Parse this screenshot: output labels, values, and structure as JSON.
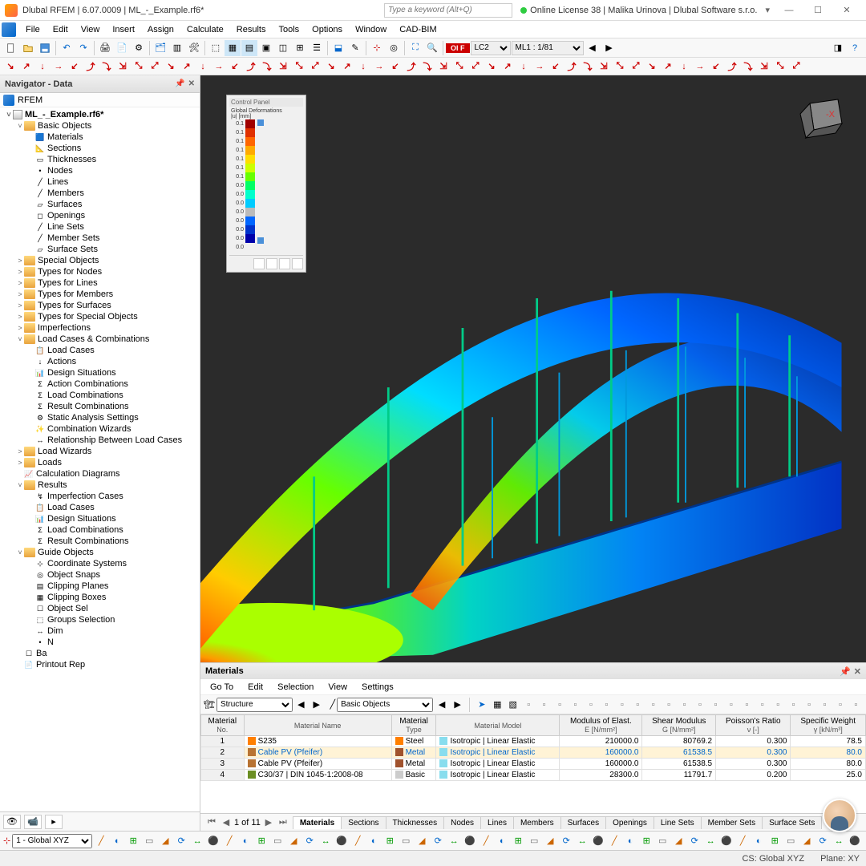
{
  "title_bar": {
    "title": "Dlubal RFEM | 6.07.0009 | ML_-_Example.rf6*",
    "search_placeholder": "Type a keyword (Alt+Q)",
    "license": "Online License 38 | Malika Urinova | Dlubal Software s.r.o."
  },
  "menu": [
    "File",
    "Edit",
    "View",
    "Insert",
    "Assign",
    "Calculate",
    "Results",
    "Tools",
    "Options",
    "Window",
    "CAD-BIM"
  ],
  "toolbar": {
    "lc_label": "Ol F",
    "lc_sel": "LC2",
    "ml_sel": "ML1 : 1/81"
  },
  "navigator": {
    "title": "Navigator - Data",
    "root": "RFEM",
    "project": "ML_-_Example.rf6*",
    "tree": [
      {
        "l": 1,
        "t": "Basic Objects",
        "tw": "˅",
        "fold": true
      },
      {
        "l": 2,
        "t": "Materials",
        "ic": "🟦"
      },
      {
        "l": 2,
        "t": "Sections",
        "ic": "📐"
      },
      {
        "l": 2,
        "t": "Thicknesses",
        "ic": "▭"
      },
      {
        "l": 2,
        "t": "Nodes",
        "ic": "•"
      },
      {
        "l": 2,
        "t": "Lines",
        "ic": "╱"
      },
      {
        "l": 2,
        "t": "Members",
        "ic": "╱"
      },
      {
        "l": 2,
        "t": "Surfaces",
        "ic": "▱"
      },
      {
        "l": 2,
        "t": "Openings",
        "ic": "◻"
      },
      {
        "l": 2,
        "t": "Line Sets",
        "ic": "╱"
      },
      {
        "l": 2,
        "t": "Member Sets",
        "ic": "╱"
      },
      {
        "l": 2,
        "t": "Surface Sets",
        "ic": "▱"
      },
      {
        "l": 1,
        "t": "Special Objects",
        "tw": ">",
        "fold": true
      },
      {
        "l": 1,
        "t": "Types for Nodes",
        "tw": ">",
        "fold": true
      },
      {
        "l": 1,
        "t": "Types for Lines",
        "tw": ">",
        "fold": true
      },
      {
        "l": 1,
        "t": "Types for Members",
        "tw": ">",
        "fold": true
      },
      {
        "l": 1,
        "t": "Types for Surfaces",
        "tw": ">",
        "fold": true
      },
      {
        "l": 1,
        "t": "Types for Special Objects",
        "tw": ">",
        "fold": true
      },
      {
        "l": 1,
        "t": "Imperfections",
        "tw": ">",
        "fold": true
      },
      {
        "l": 1,
        "t": "Load Cases & Combinations",
        "tw": "˅",
        "fold": true
      },
      {
        "l": 2,
        "t": "Load Cases",
        "ic": "📋"
      },
      {
        "l": 2,
        "t": "Actions",
        "ic": "↓"
      },
      {
        "l": 2,
        "t": "Design Situations",
        "ic": "📊"
      },
      {
        "l": 2,
        "t": "Action Combinations",
        "ic": "Σ"
      },
      {
        "l": 2,
        "t": "Load Combinations",
        "ic": "Σ"
      },
      {
        "l": 2,
        "t": "Result Combinations",
        "ic": "Σ"
      },
      {
        "l": 2,
        "t": "Static Analysis Settings",
        "ic": "⚙"
      },
      {
        "l": 2,
        "t": "Combination Wizards",
        "ic": "✨"
      },
      {
        "l": 2,
        "t": "Relationship Between Load Cases",
        "ic": "↔"
      },
      {
        "l": 1,
        "t": "Load Wizards",
        "tw": ">",
        "fold": true
      },
      {
        "l": 1,
        "t": "Loads",
        "tw": ">",
        "fold": true
      },
      {
        "l": 1,
        "t": "Calculation Diagrams",
        "ic": "📈"
      },
      {
        "l": 1,
        "t": "Results",
        "tw": "˅",
        "fold": true
      },
      {
        "l": 2,
        "t": "Imperfection Cases",
        "ic": "↯"
      },
      {
        "l": 2,
        "t": "Load Cases",
        "ic": "📋"
      },
      {
        "l": 2,
        "t": "Design Situations",
        "ic": "📊"
      },
      {
        "l": 2,
        "t": "Load Combinations",
        "ic": "Σ"
      },
      {
        "l": 2,
        "t": "Result Combinations",
        "ic": "Σ"
      },
      {
        "l": 1,
        "t": "Guide Objects",
        "tw": "˅",
        "fold": true
      },
      {
        "l": 2,
        "t": "Coordinate Systems",
        "ic": "⊹"
      },
      {
        "l": 2,
        "t": "Object Snaps",
        "ic": "◎"
      },
      {
        "l": 2,
        "t": "Clipping Planes",
        "ic": "▤"
      },
      {
        "l": 2,
        "t": "Clipping Boxes",
        "ic": "▦"
      },
      {
        "l": 2,
        "t": "Object Sel",
        "ic": "☐"
      },
      {
        "l": 2,
        "t": "Groups        Selection",
        "ic": "⬚"
      },
      {
        "l": 2,
        "t": "Dim",
        "ic": "↔"
      },
      {
        "l": 2,
        "t": "N",
        "ic": "•"
      },
      {
        "l": 1,
        "t": "Ba",
        "ic": "☐"
      },
      {
        "l": 1,
        "t": "Printout Rep",
        "ic": "📄"
      }
    ]
  },
  "control_panel": {
    "title": "Control Panel",
    "subtitle": "Global Deformations",
    "unit": "|u| [mm]",
    "scale": [
      {
        "v": "0.1",
        "c": "#a00000"
      },
      {
        "v": "0.1",
        "c": "#e03000"
      },
      {
        "v": "0.1",
        "c": "#ff6600"
      },
      {
        "v": "0.1",
        "c": "#ffaa00"
      },
      {
        "v": "0.1",
        "c": "#ffdd00"
      },
      {
        "v": "0.1",
        "c": "#ccff00"
      },
      {
        "v": "0.1",
        "c": "#66ff00"
      },
      {
        "v": "0.0",
        "c": "#00ff66"
      },
      {
        "v": "0.0",
        "c": "#00ffcc"
      },
      {
        "v": "0.0",
        "c": "#00ccff"
      },
      {
        "v": "0.0",
        "c": "#bbbbbb"
      },
      {
        "v": "0.0",
        "c": "#0066ff"
      },
      {
        "v": "0.0",
        "c": "#0033cc"
      },
      {
        "v": "0.0",
        "c": "#0000aa"
      },
      {
        "v": "0.0",
        "c": ""
      }
    ]
  },
  "materials_panel": {
    "title": "Materials",
    "menu": [
      "Go To",
      "Edit",
      "Selection",
      "View",
      "Settings"
    ],
    "struct_sel": "Structure",
    "objects_sel": "Basic Objects",
    "columns": [
      {
        "h": "Material",
        "s": "No."
      },
      {
        "h": "",
        "s": "Material Name"
      },
      {
        "h": "Material",
        "s": "Type"
      },
      {
        "h": "",
        "s": "Material Model"
      },
      {
        "h": "Modulus of Elast.",
        "s": "E [N/mm²]"
      },
      {
        "h": "Shear Modulus",
        "s": "G [N/mm²]"
      },
      {
        "h": "Poisson's Ratio",
        "s": "ν [-]"
      },
      {
        "h": "Specific Weight",
        "s": "γ [kN/m³]"
      }
    ],
    "rows": [
      {
        "no": "1",
        "name": "S235",
        "nc": "#ff7f00",
        "type": "Steel",
        "tc": "#ff7f00",
        "model": "Isotropic | Linear Elastic",
        "e": "210000.0",
        "g": "80769.2",
        "v": "0.300",
        "w": "78.5"
      },
      {
        "no": "2",
        "name": "Cable PV (Pfeifer)",
        "nc": "#b87333",
        "type": "Metal",
        "tc": "#a0522d",
        "model": "Isotropic | Linear Elastic",
        "e": "160000.0",
        "g": "61538.5",
        "v": "0.300",
        "w": "80.0",
        "sel": true,
        "link": true
      },
      {
        "no": "3",
        "name": "Cable PV (Pfeifer)",
        "nc": "#b87333",
        "type": "Metal",
        "tc": "#a0522d",
        "model": "Isotropic | Linear Elastic",
        "e": "160000.0",
        "g": "61538.5",
        "v": "0.300",
        "w": "80.0"
      },
      {
        "no": "4",
        "name": "C30/37 | DIN 1045-1:2008-08",
        "nc": "#6b8e23",
        "type": "Basic",
        "tc": "",
        "model": "Isotropic | Linear Elastic",
        "e": "28300.0",
        "g": "11791.7",
        "v": "0.200",
        "w": "25.0"
      }
    ],
    "pager": "1 of 11",
    "tabs": [
      "Materials",
      "Sections",
      "Thicknesses",
      "Nodes",
      "Lines",
      "Members",
      "Surfaces",
      "Openings",
      "Line Sets",
      "Member Sets",
      "Surface Sets"
    ]
  },
  "status_toolbar": {
    "cs_sel": "1 - Global XYZ"
  },
  "status_bar": {
    "cs": "CS: Global XYZ",
    "plane": "Plane: XY"
  }
}
